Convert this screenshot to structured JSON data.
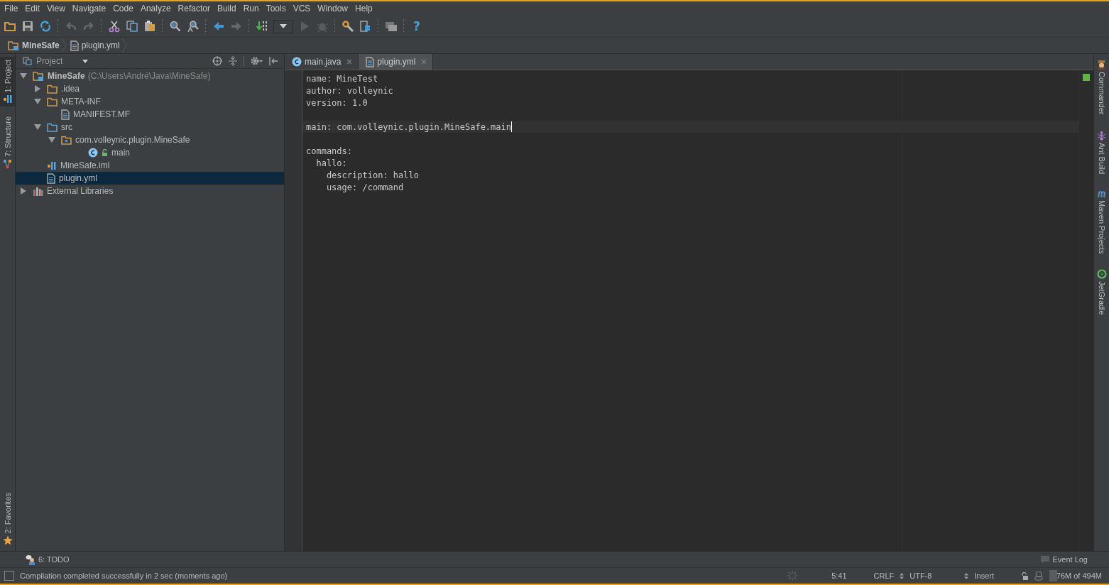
{
  "menu": [
    "File",
    "Edit",
    "View",
    "Navigate",
    "Code",
    "Analyze",
    "Refactor",
    "Build",
    "Run",
    "Tools",
    "VCS",
    "Window",
    "Help"
  ],
  "toolbar": {
    "help": "?"
  },
  "breadcrumbs": [
    {
      "label": "MineSafe",
      "kind": "module"
    },
    {
      "label": "plugin.yml",
      "kind": "file"
    }
  ],
  "left_stripe": [
    {
      "label": "1: Project",
      "kind": "module-file",
      "selected": true
    },
    {
      "label": "7: Structure",
      "kind": "structure",
      "selected": false
    }
  ],
  "left_stripe_bottom": [
    {
      "label": "2: Favorites",
      "kind": "star",
      "selected": false
    }
  ],
  "project": {
    "view": "Project",
    "tree": [
      {
        "label": "MineSafe",
        "note": "(C:\\Users\\André\\Java\\MineSafe)",
        "kind": "module",
        "expanded": true,
        "selected": false,
        "children": [
          {
            "label": ".idea",
            "kind": "folder",
            "expanded": false,
            "selected": false
          },
          {
            "label": "META-INF",
            "kind": "folder",
            "expanded": true,
            "selected": false,
            "children": [
              {
                "label": "MANIFEST.MF",
                "kind": "file",
                "selected": false
              }
            ]
          },
          {
            "label": "src",
            "kind": "source",
            "expanded": true,
            "selected": false,
            "children": [
              {
                "label": "com.volleynic.plugin.MineSafe",
                "kind": "package",
                "expanded": true,
                "selected": false,
                "children": [
                  {
                    "label": "main",
                    "kind": "class",
                    "selected": false
                  }
                ]
              }
            ]
          },
          {
            "label": "MineSafe.iml",
            "kind": "module-file",
            "selected": false
          },
          {
            "label": "plugin.yml",
            "kind": "file",
            "selected": true
          }
        ]
      },
      {
        "label": "External Libraries",
        "kind": "libraries",
        "expanded": false,
        "selected": false
      }
    ]
  },
  "editor": {
    "tabs": [
      {
        "label": "main.java",
        "kind": "class",
        "selected": false
      },
      {
        "label": "plugin.yml",
        "kind": "file",
        "selected": true
      }
    ],
    "lines": [
      {
        "text": "name: MineTest",
        "current": false
      },
      {
        "text": "author: volleynic",
        "current": false
      },
      {
        "text": "version: 1.0",
        "current": false
      },
      {
        "current": false
      },
      {
        "text": "main: com.volleynic.plugin.MineSafe.main",
        "current": true
      },
      {
        "current": false
      },
      {
        "text": "commands:",
        "current": false
      },
      {
        "text": "  hallo:",
        "current": false
      },
      {
        "text": "    description: hallo",
        "current": false
      },
      {
        "text": "    usage: /command",
        "current": false
      }
    ]
  },
  "right_stripe": [
    {
      "label": "Commander",
      "kind": "commander"
    },
    {
      "label": "Ant Build",
      "kind": "ant"
    },
    {
      "label": "Maven Projects",
      "kind": "maven"
    },
    {
      "label": "JetGradle",
      "kind": "gradle"
    }
  ],
  "bottom_tools": [
    {
      "label": "6: TODO",
      "kind": "todo"
    }
  ],
  "event_log": "Event Log",
  "status": {
    "message": "Compilation completed successfully in 2 sec (moments ago)",
    "position": "5:41",
    "line_separator": "CRLF",
    "encoding": "UTF-8",
    "insert_mode": "Insert",
    "memory": {
      "label": "76M of 494M",
      "level": 0.15
    }
  }
}
